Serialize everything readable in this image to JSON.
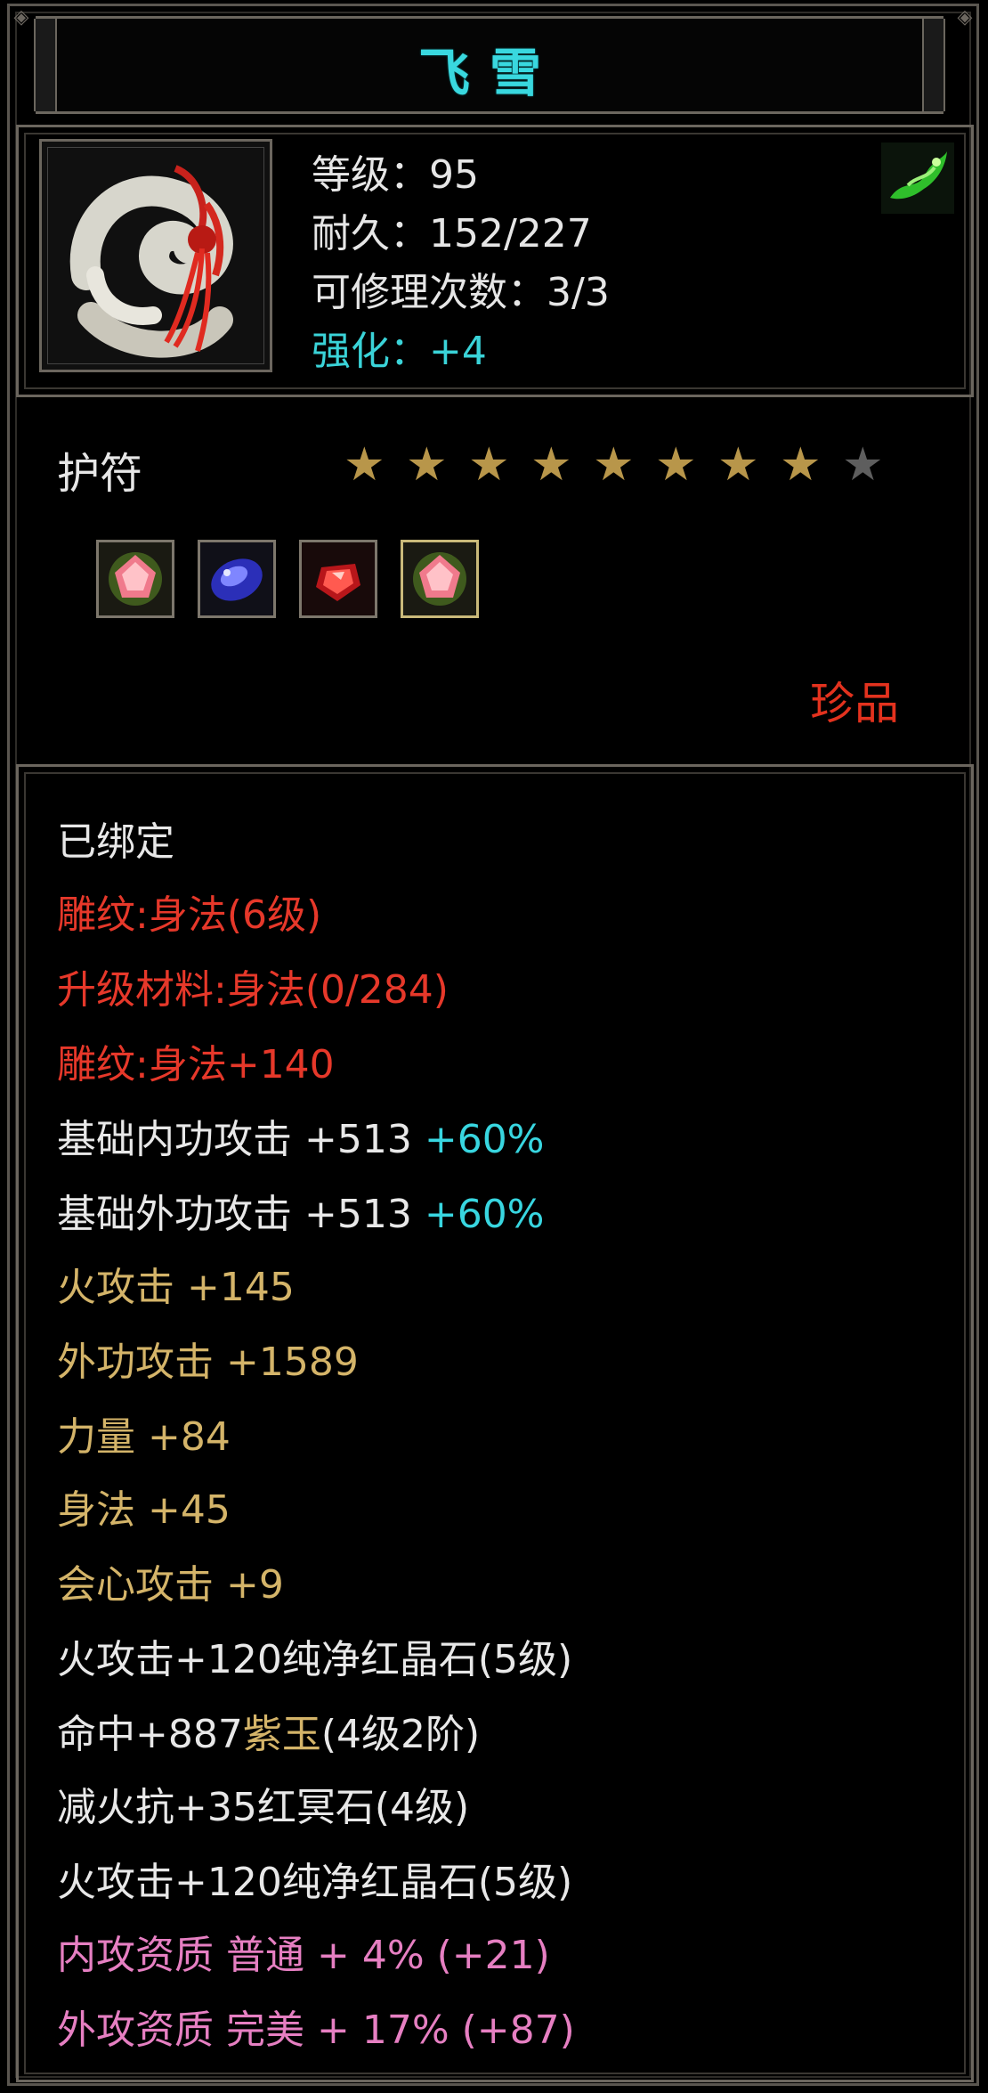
{
  "item": {
    "name": "飞雪",
    "level_label": "等级：95",
    "durability_label": "耐久：152/227",
    "repair_label": "可修理次数：3/3",
    "enhance_label": "强化：+4",
    "category": "护符",
    "rarity": "珍品",
    "stars": {
      "filled": 8,
      "total": 9
    },
    "icon": "jade-amulet-icon",
    "badge_icon": "green-dragon-icon"
  },
  "sockets": [
    {
      "icon": "pink-gem-icon"
    },
    {
      "icon": "blue-sapphire-icon"
    },
    {
      "icon": "red-crystal-icon"
    },
    {
      "icon": "pink-gem-icon"
    }
  ],
  "attributes": {
    "bound": "已绑定",
    "engrave_1": "雕纹:身法(6级)",
    "upgrade_material": "升级材料:身法(0/284)",
    "engrave_2": "雕纹:身法+140",
    "base_inner_attack": "基础内功攻击 +513 ",
    "base_inner_attack_pct": "+60%",
    "base_outer_attack": "基础外功攻击 +513 ",
    "base_outer_attack_pct": "+60%",
    "fire_attack": "火攻击 +145",
    "outer_attack": "外功攻击 +1589",
    "strength": "力量 +84",
    "agility": "身法 +45",
    "critical": "会心攻击 +9",
    "gem_1_prefix": "火攻击+120纯净红晶石(5级)",
    "gem_2_prefix": "命中+887",
    "gem_2_name": "紫玉",
    "gem_2_suffix": "(4级2阶)",
    "gem_3": "减火抗+35红冥石(4级)",
    "gem_4": "火攻击+120纯净红晶石(5级)",
    "inner_quality": "内攻资质 普通 + 4% (+21)",
    "outer_quality": "外攻资质 完美 + 17% (+87)"
  },
  "colors": {
    "title": "#39d8df",
    "rarity": "#e3321e",
    "star_filled": "#b8964a",
    "star_empty": "#5e5e5e"
  }
}
